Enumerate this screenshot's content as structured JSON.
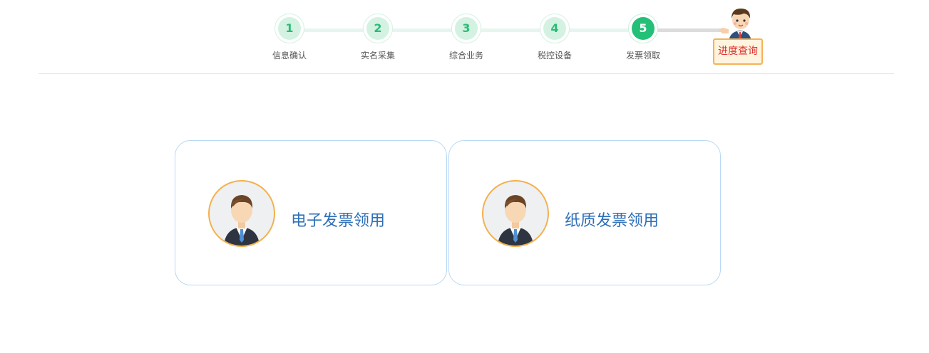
{
  "steps": [
    {
      "number": "1",
      "label": "信息确认"
    },
    {
      "number": "2",
      "label": "实名采集"
    },
    {
      "number": "3",
      "label": "综合业务"
    },
    {
      "number": "4",
      "label": "税控设备"
    },
    {
      "number": "5",
      "label": "发票领取"
    }
  ],
  "active_step": 5,
  "progress_query": {
    "label": "进度查询",
    "icon": "cartoon-person-icon"
  },
  "options": [
    {
      "label": "电子发票领用",
      "icon": "businessman-avatar-icon"
    },
    {
      "label": "纸质发票领用",
      "icon": "businessman-avatar-icon"
    }
  ],
  "colors": {
    "step_done_bg": "#d3f2e2",
    "step_done_text": "#2bbb77",
    "step_active_bg": "#24c077",
    "card_border": "#b7d8f5",
    "card_text": "#2d6fb8",
    "avatar_border": "#f5b04a",
    "query_text": "#e0302f",
    "query_border": "#f5b25a"
  }
}
